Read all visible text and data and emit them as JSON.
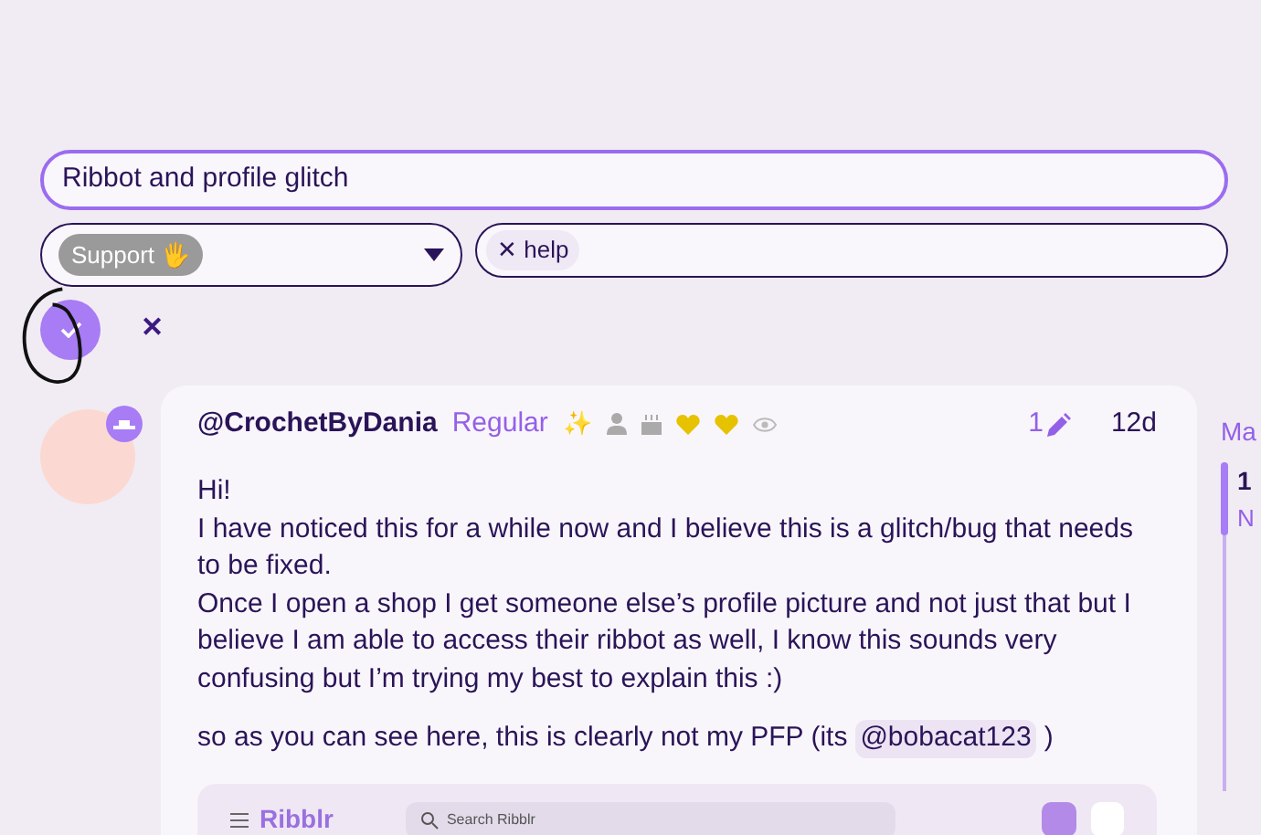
{
  "composer": {
    "title_field": {
      "value": "Ribbot and profile glitch"
    },
    "category": {
      "badge": "Support 🖐"
    },
    "tags": [
      {
        "label": "help",
        "remove": "✕"
      }
    ],
    "cancel": "✕"
  },
  "post": {
    "username": "@CrochetByDania",
    "user_title": "Regular",
    "flair": "✨",
    "edits": "1",
    "age": "12d",
    "paragraphs": [
      "Hi!\nI have noticed this for a while now and I believe this is a glitch/bug that needs to be fixed.\nOnce I open a shop I get someone else’s profile picture and not just that but I believe I am able to access their ribbot as well, I know this sounds very confusing but I’m trying my best to explain this :)"
    ],
    "mention_line": {
      "text": "so as you can see here, this is clearly not my PFP (its",
      "mention": "@bobacat123",
      "close": ")"
    },
    "screenshot": {
      "logo": "Ribblr",
      "search_placeholder": "Search Ribblr"
    }
  },
  "timeline": {
    "month": "Ma",
    "number": "1",
    "label": "N"
  }
}
